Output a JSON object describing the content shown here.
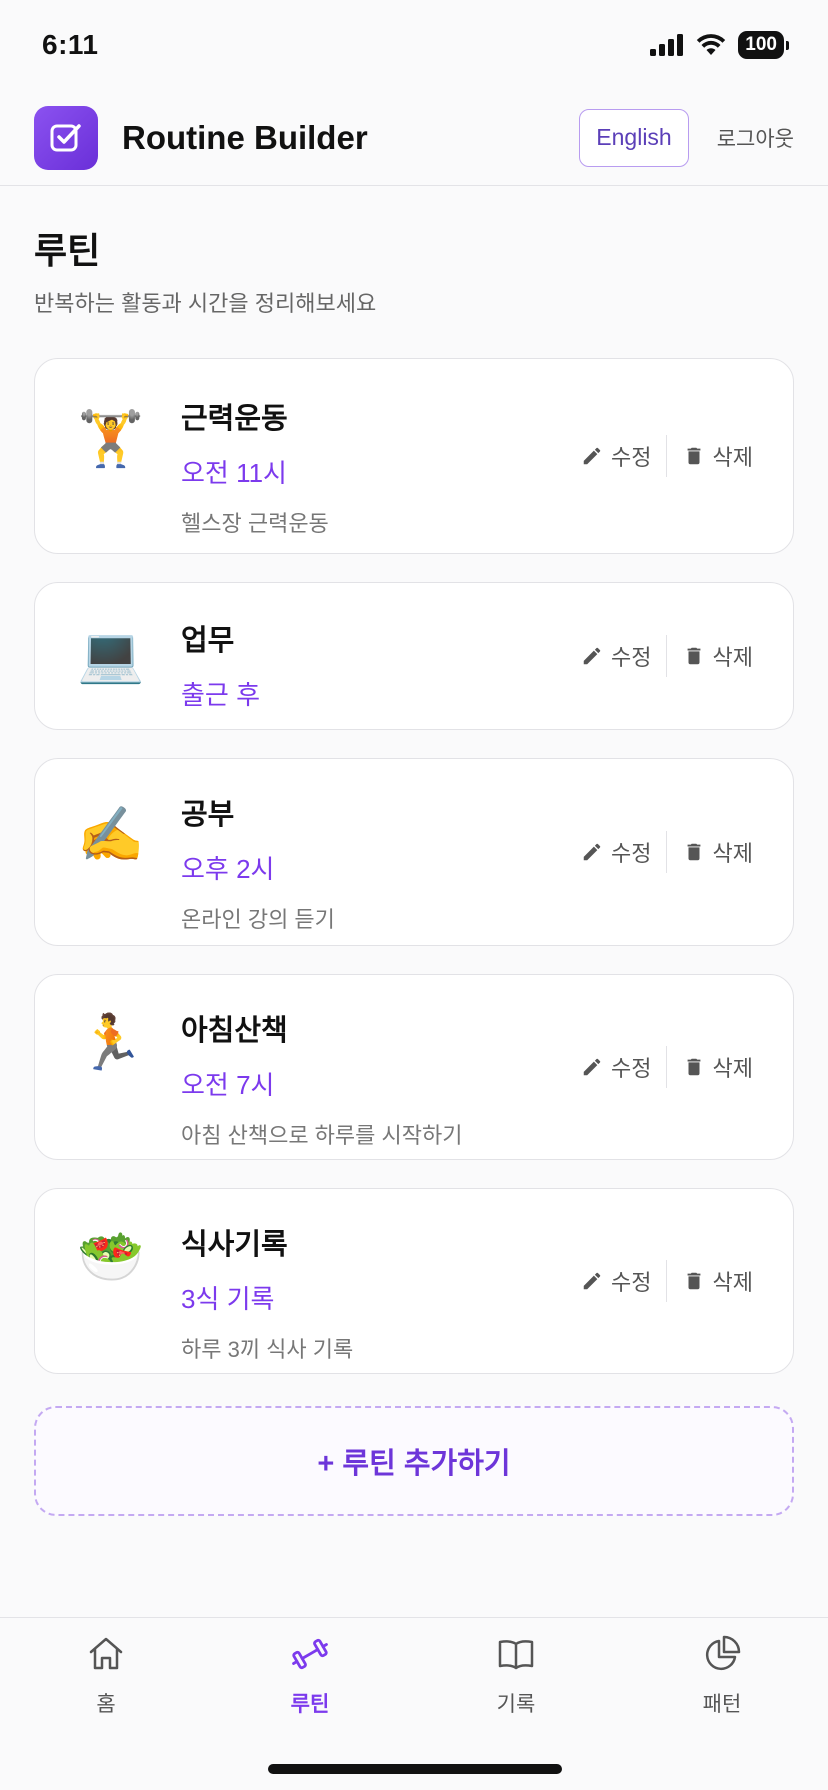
{
  "status": {
    "time": "6:11",
    "battery": "100"
  },
  "header": {
    "title": "Routine Builder",
    "language": "English",
    "logout": "로그아웃"
  },
  "page": {
    "title": "루틴",
    "subtitle": "반복하는 활동과 시간을 정리해보세요"
  },
  "actions": {
    "edit": "수정",
    "delete": "삭제"
  },
  "routines": [
    {
      "emoji": "🏋️",
      "icon": "weightlifter-emoji",
      "name": "근력운동",
      "time": "오전 11시",
      "desc": "헬스장 근력운동"
    },
    {
      "emoji": "💻",
      "icon": "laptop-emoji",
      "name": "업무",
      "time": "출근 후",
      "desc": ""
    },
    {
      "emoji": "✍️",
      "icon": "writing-hand-emoji",
      "name": "공부",
      "time": "오후 2시",
      "desc": "온라인 강의 듣기"
    },
    {
      "emoji": "🏃",
      "icon": "runner-emoji",
      "name": "아침산책",
      "time": "오전 7시",
      "desc": "아침 산책으로 하루를 시작하기"
    },
    {
      "emoji": "🥗",
      "icon": "salad-emoji",
      "name": "식사기록",
      "time": "3식 기록",
      "desc": "하루 3끼 식사 기록"
    }
  ],
  "add_button": "+ 루틴 추가하기",
  "tabs": [
    {
      "label": "홈",
      "icon": "home-icon"
    },
    {
      "label": "루틴",
      "icon": "dumbbell-icon",
      "active": true
    },
    {
      "label": "기록",
      "icon": "book-icon"
    },
    {
      "label": "패턴",
      "icon": "pie-chart-icon"
    }
  ],
  "colors": {
    "accent": "#7c3aed",
    "logo": "#7c3aed",
    "text_muted": "#777777"
  }
}
